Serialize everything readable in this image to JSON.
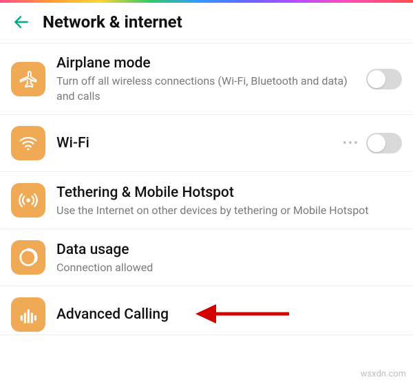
{
  "header": {
    "title": "Network & internet"
  },
  "items": {
    "airplane": {
      "title": "Airplane mode",
      "sub": "Turn off all wireless connections (Wi-Fi, Bluetooth and data) and calls"
    },
    "wifi": {
      "title": "Wi-Fi"
    },
    "tethering": {
      "title": "Tethering & Mobile Hotspot",
      "sub": "Use the Internet on other devices by tethering or Mobile Hotspot"
    },
    "data_usage": {
      "title": "Data usage",
      "sub": "Connection allowed"
    },
    "advanced_calling": {
      "title": "Advanced Calling"
    }
  },
  "watermark": "wsxdn.com"
}
